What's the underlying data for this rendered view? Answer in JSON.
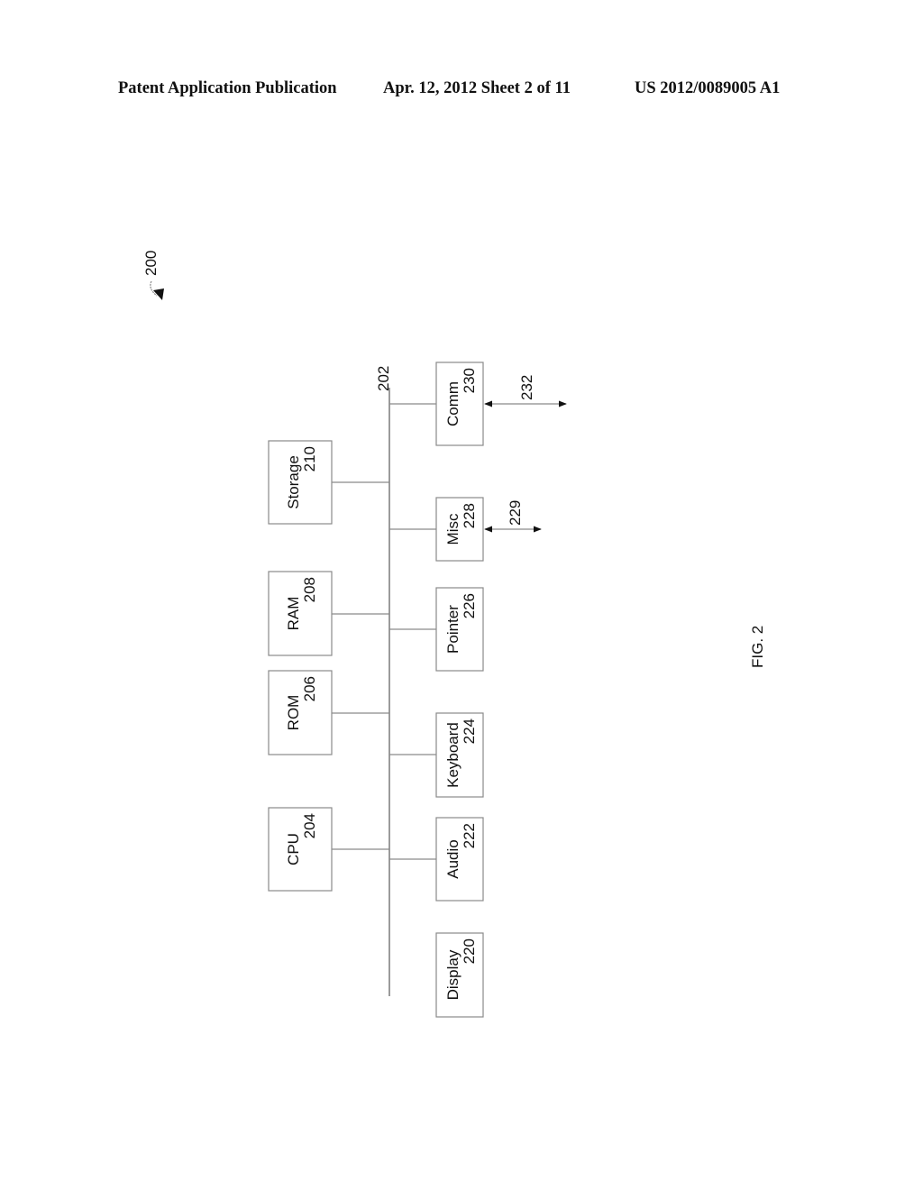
{
  "header": {
    "publication": "Patent Application Publication",
    "date_sheet": "Apr. 12, 2012  Sheet 2 of 11",
    "number": "US 2012/0089005 A1"
  },
  "figure": {
    "ref": "200",
    "caption": "FIG. 2",
    "bus": {
      "ref": "202"
    },
    "upper_components": [
      {
        "id": "storage",
        "label": "Storage",
        "ref": "210"
      },
      {
        "id": "ram",
        "label": "RAM",
        "ref": "208"
      },
      {
        "id": "rom",
        "label": "ROM",
        "ref": "206"
      },
      {
        "id": "cpu",
        "label": "CPU",
        "ref": "204"
      }
    ],
    "lower_components": [
      {
        "id": "comm",
        "label": "Comm",
        "ref": "230",
        "external_link": "232"
      },
      {
        "id": "misc",
        "label": "Misc",
        "ref": "228",
        "external_link": "229"
      },
      {
        "id": "pointer",
        "label": "Pointer",
        "ref": "226"
      },
      {
        "id": "keyboard",
        "label": "Keyboard",
        "ref": "224"
      },
      {
        "id": "audio",
        "label": "Audio",
        "ref": "222"
      },
      {
        "id": "display",
        "label": "Display",
        "ref": "220"
      }
    ]
  }
}
